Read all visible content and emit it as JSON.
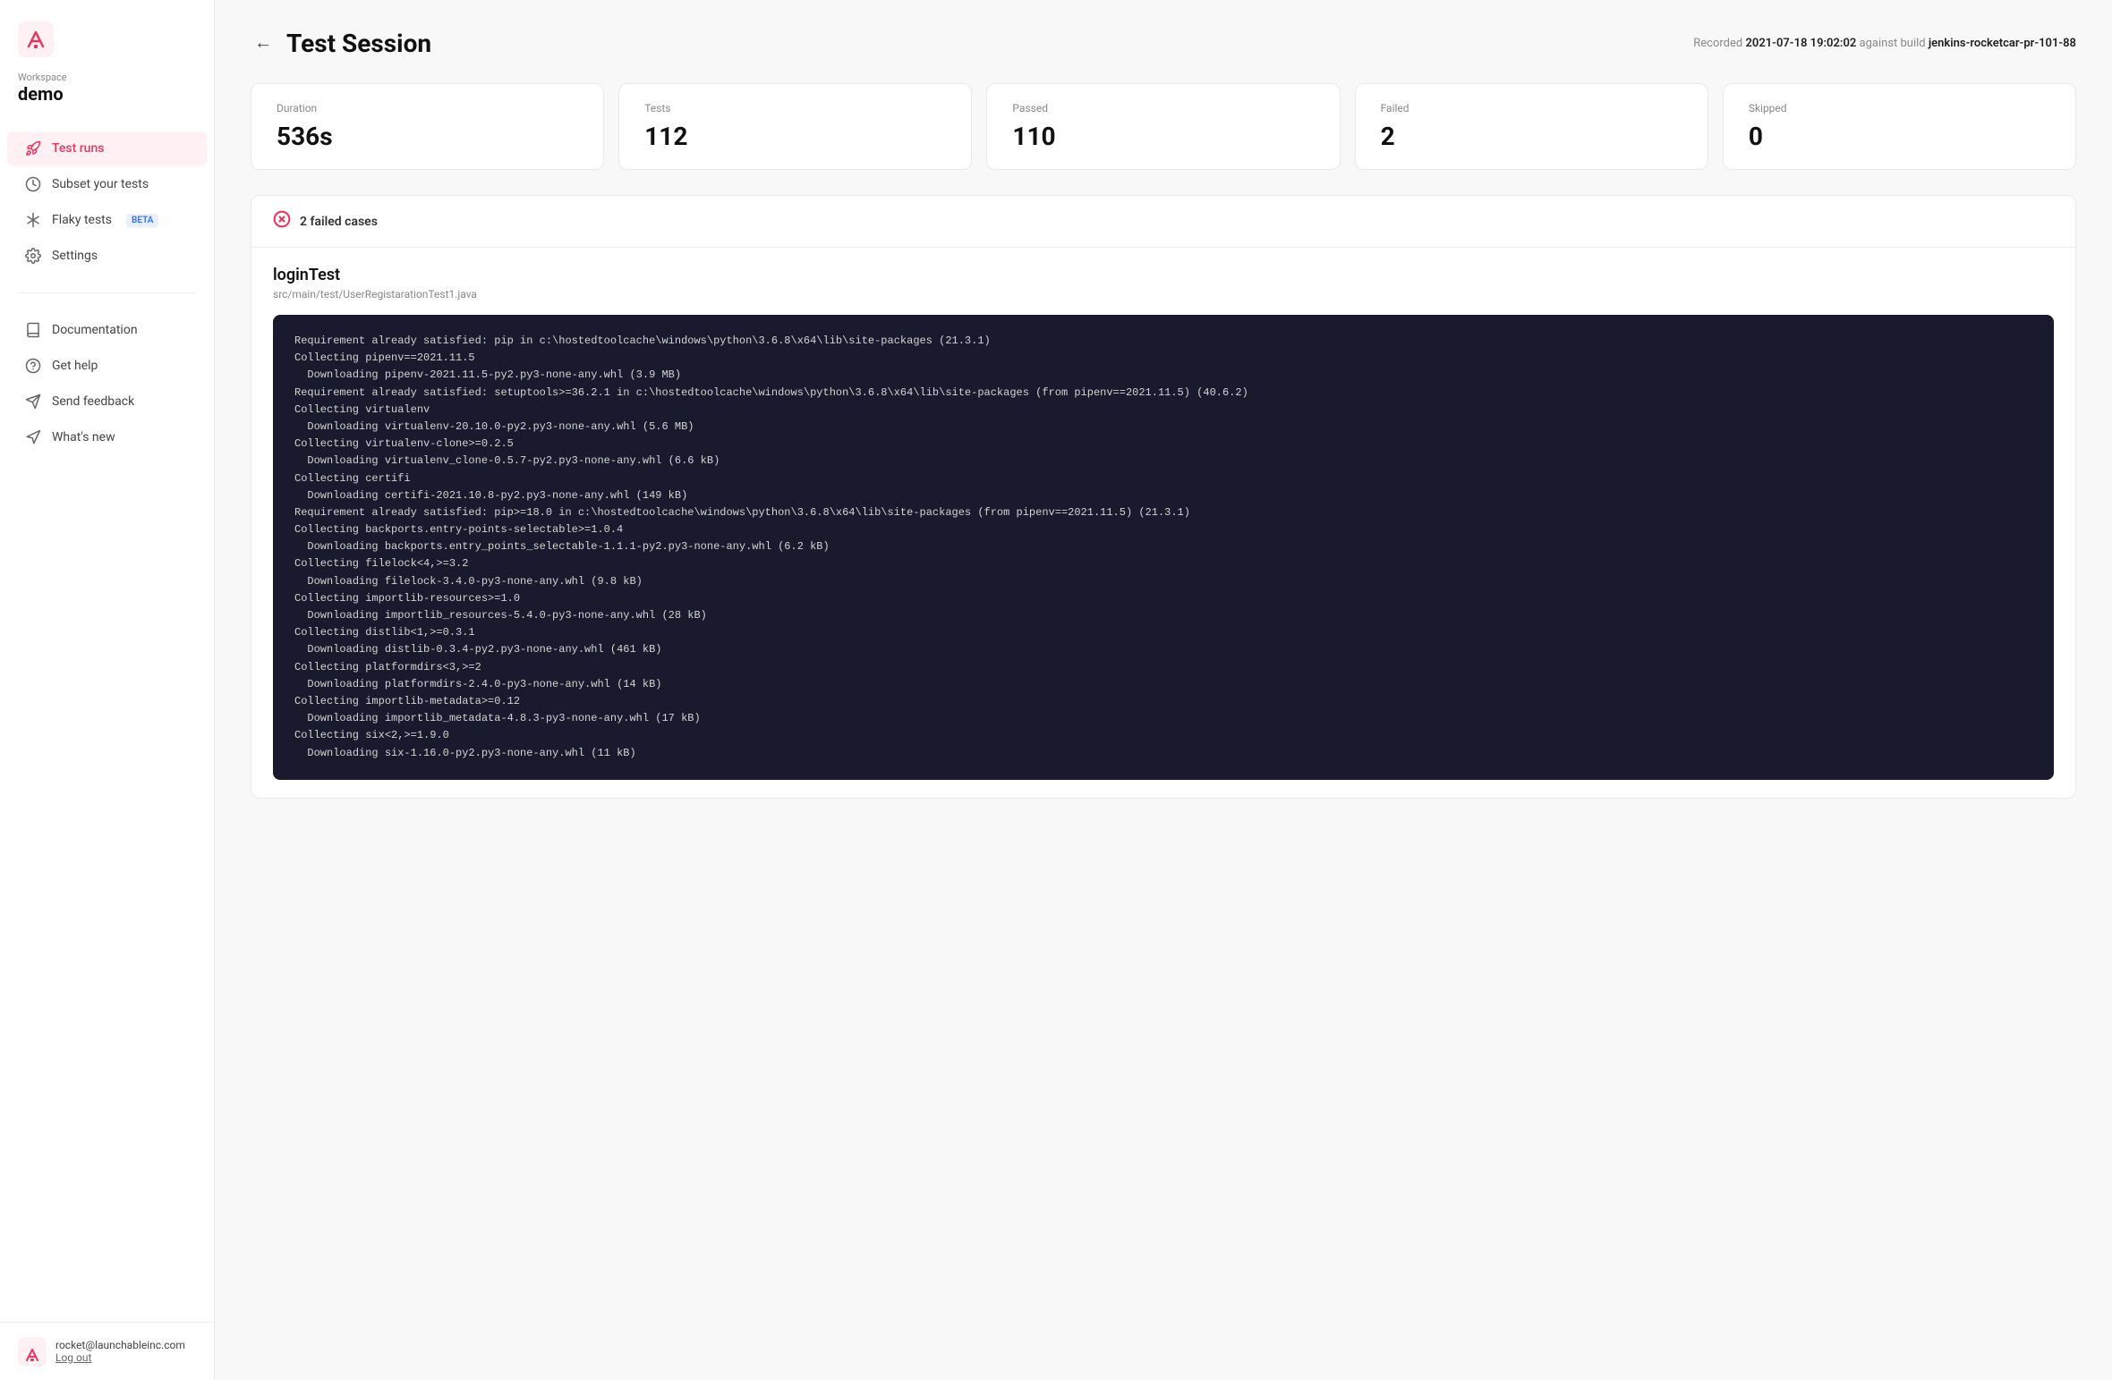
{
  "sidebar": {
    "workspace_label": "Workspace",
    "workspace_name": "demo",
    "nav_items": [
      {
        "id": "test-runs",
        "label": "Test runs",
        "icon": "rocket",
        "active": true
      },
      {
        "id": "subset-tests",
        "label": "Subset your tests",
        "icon": "clock",
        "active": false
      },
      {
        "id": "flaky-tests",
        "label": "Flaky tests",
        "icon": "asterisk",
        "active": false,
        "badge": "BETA"
      },
      {
        "id": "settings",
        "label": "Settings",
        "icon": "gear",
        "active": false
      }
    ],
    "bottom_items": [
      {
        "id": "documentation",
        "label": "Documentation",
        "icon": "book"
      },
      {
        "id": "get-help",
        "label": "Get help",
        "icon": "help-circle"
      },
      {
        "id": "send-feedback",
        "label": "Send feedback",
        "icon": "send"
      },
      {
        "id": "whats-new",
        "label": "What's new",
        "icon": "megaphone"
      }
    ],
    "user": {
      "email": "rocket@launchableinc.com",
      "logout_label": "Log out"
    }
  },
  "page": {
    "title": "Test Session",
    "back_label": "←",
    "meta_prefix": "Recorded",
    "meta_datetime": "2021-07-18 19:02:02",
    "meta_against": "against build",
    "meta_build": "jenkins-rocketcar-pr-101-88"
  },
  "stats": [
    {
      "label": "Duration",
      "value": "536s"
    },
    {
      "label": "Tests",
      "value": "112"
    },
    {
      "label": "Passed",
      "value": "110"
    },
    {
      "label": "Failed",
      "value": "2"
    },
    {
      "label": "Skipped",
      "value": "0"
    }
  ],
  "failed_section": {
    "header": "2 failed cases",
    "test_case": {
      "name": "loginTest",
      "path": "src/main/test/UserRegistarationTest1.java",
      "terminal_output": "Requirement already satisfied: pip in c:\\hostedtoolcache\\windows\\python\\3.6.8\\x64\\lib\\site-packages (21.3.1)\nCollecting pipenv==2021.11.5\n  Downloading pipenv-2021.11.5-py2.py3-none-any.whl (3.9 MB)\nRequirement already satisfied: setuptools>=36.2.1 in c:\\hostedtoolcache\\windows\\python\\3.6.8\\x64\\lib\\site-packages (from pipenv==2021.11.5) (40.6.2)\nCollecting virtualenv\n  Downloading virtualenv-20.10.0-py2.py3-none-any.whl (5.6 MB)\nCollecting virtualenv-clone>=0.2.5\n  Downloading virtualenv_clone-0.5.7-py2.py3-none-any.whl (6.6 kB)\nCollecting certifi\n  Downloading certifi-2021.10.8-py2.py3-none-any.whl (149 kB)\nRequirement already satisfied: pip>=18.0 in c:\\hostedtoolcache\\windows\\python\\3.6.8\\x64\\lib\\site-packages (from pipenv==2021.11.5) (21.3.1)\nCollecting backports.entry-points-selectable>=1.0.4\n  Downloading backports.entry_points_selectable-1.1.1-py2.py3-none-any.whl (6.2 kB)\nCollecting filelock<4,>=3.2\n  Downloading filelock-3.4.0-py3-none-any.whl (9.8 kB)\nCollecting importlib-resources>=1.0\n  Downloading importlib_resources-5.4.0-py3-none-any.whl (28 kB)\nCollecting distlib<1,>=0.3.1\n  Downloading distlib-0.3.4-py2.py3-none-any.whl (461 kB)\nCollecting platformdirs<3,>=2\n  Downloading platformdirs-2.4.0-py3-none-any.whl (14 kB)\nCollecting importlib-metadata>=0.12\n  Downloading importlib_metadata-4.8.3-py3-none-any.whl (17 kB)\nCollecting six<2,>=1.9.0\n  Downloading six-1.16.0-py2.py3-none-any.whl (11 kB)"
    }
  }
}
